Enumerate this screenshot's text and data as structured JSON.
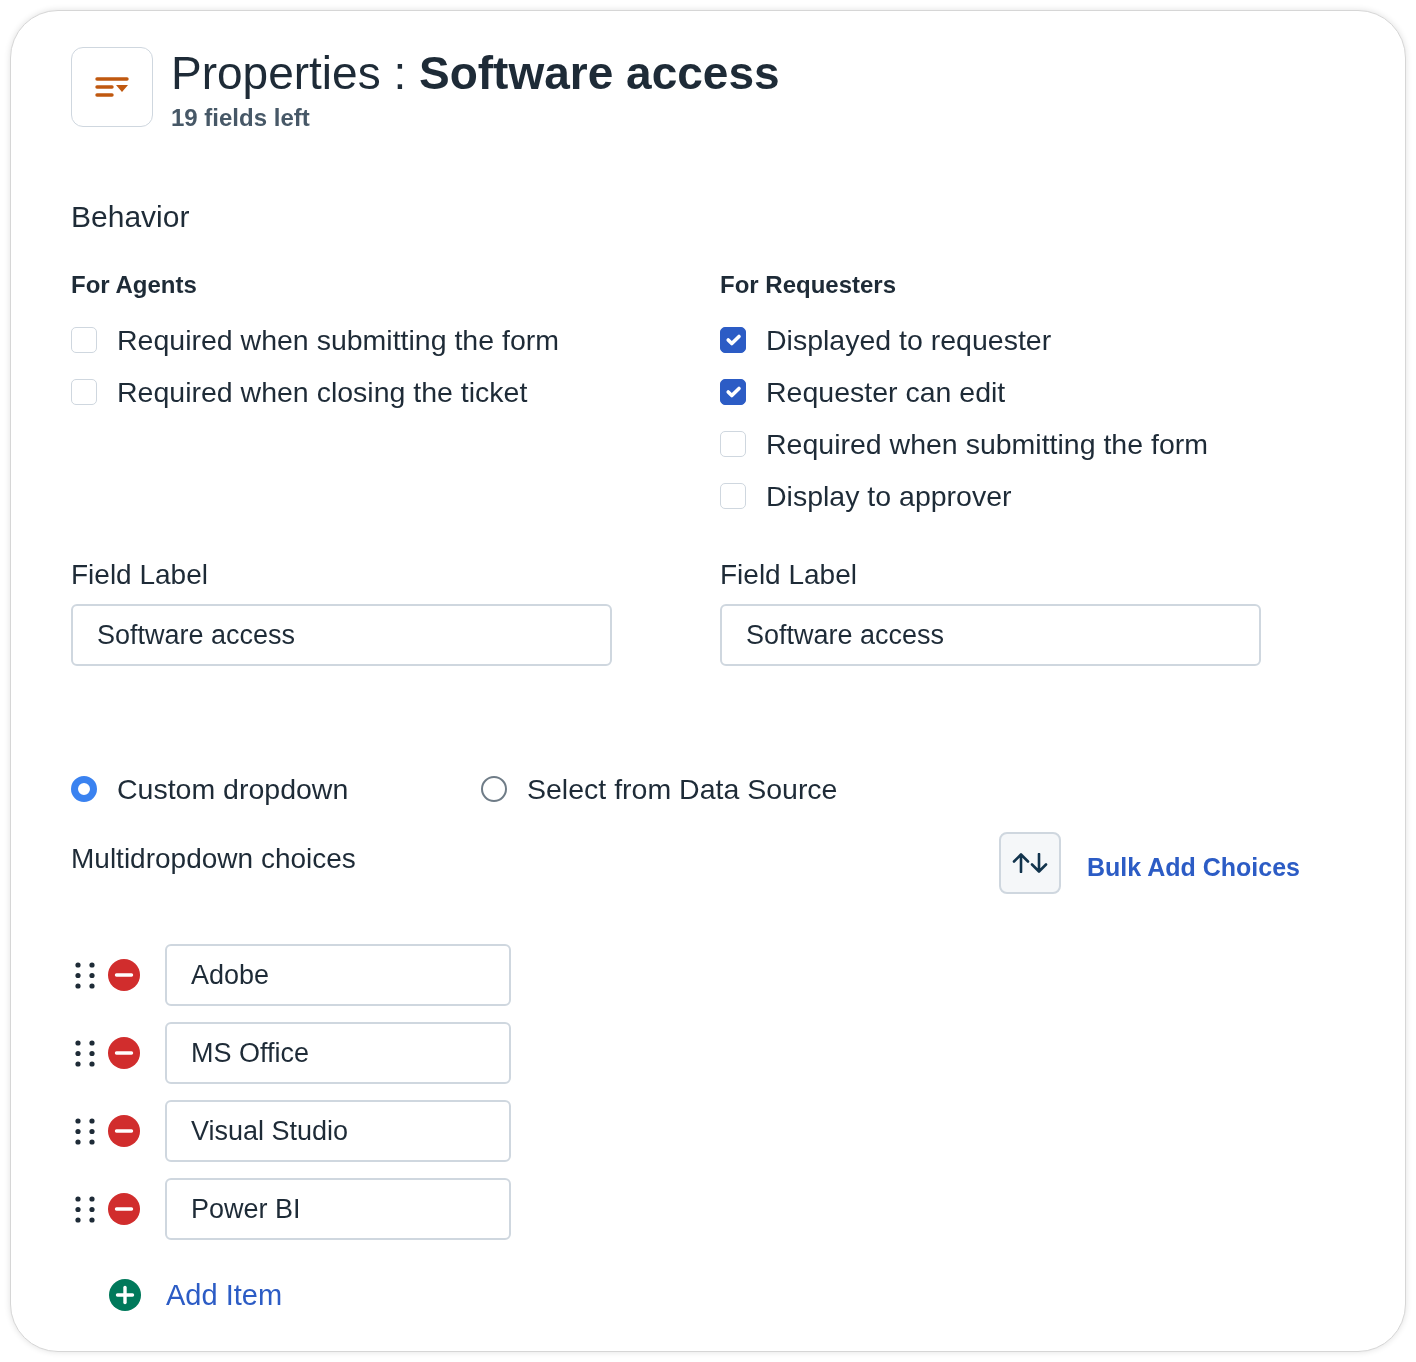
{
  "header": {
    "title": "Properties : **Software access**",
    "subtitle": "19 fields left"
  },
  "behavior": {
    "heading": "Behavior",
    "groups": [
      {
        "heading": "For Agents",
        "options": [
          {
            "label": "Required when submitting the form",
            "checked": false
          },
          {
            "label": "Required when closing the ticket",
            "checked": false
          }
        ],
        "field_label": {
          "label": "Field Label",
          "value": "Software access"
        }
      },
      {
        "heading": "For Requesters",
        "options": [
          {
            "label": "Displayed to requester",
            "checked": true
          },
          {
            "label": "Requester can edit",
            "checked": true
          },
          {
            "label": "Required when submitting the form",
            "checked": false
          },
          {
            "label": "Display to approver",
            "checked": false
          }
        ],
        "field_label": {
          "label": "Field Label",
          "value": "Software access"
        }
      }
    ]
  },
  "source_options": [
    {
      "label": "Custom dropdown",
      "selected": true
    },
    {
      "label": "Select from Data Source",
      "selected": false
    }
  ],
  "choices": {
    "heading": "Multidropdown choices",
    "bulk_add_link": "Bulk Add Choices",
    "items": [
      "Adobe",
      "MS Office",
      "Visual Studio",
      "Power BI"
    ],
    "add_item": "Add Item"
  }
}
